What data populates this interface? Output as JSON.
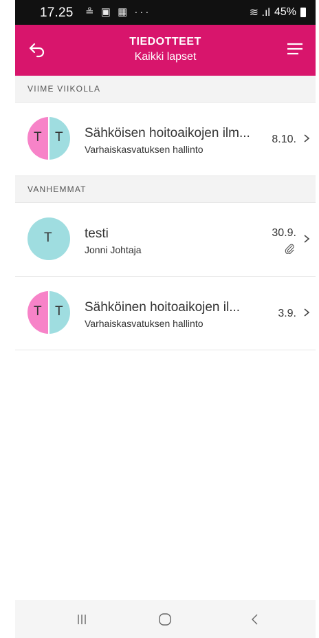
{
  "status_bar": {
    "time": "17.25",
    "notification_icons": "≗ ▣ ▦ ···",
    "signal_text": "≋ .ıl",
    "battery": "45%"
  },
  "header": {
    "title": "TIEDOTTEET",
    "subtitle": "Kaikki lapset",
    "background_color": "#d8156c"
  },
  "sections": [
    {
      "label": "VIIME VIIKOLLA",
      "items": [
        {
          "title": "Sähköisen hoitoaikojen ilm...",
          "sender": "Varhaiskasvatuksen hallinto",
          "date": "8.10.",
          "avatar_letters": [
            "T",
            "T"
          ],
          "has_attachment": false
        }
      ]
    },
    {
      "label": "VANHEMMAT",
      "items": [
        {
          "title": "testi",
          "sender": "Jonni Johtaja",
          "date": "30.9.",
          "avatar_letters": [
            "T"
          ],
          "has_attachment": true
        },
        {
          "title": "Sähköinen hoitoaikojen il...",
          "sender": "Varhaiskasvatuksen hallinto",
          "date": "3.9.",
          "avatar_letters": [
            "T",
            "T"
          ],
          "has_attachment": false
        }
      ]
    }
  ],
  "colors": {
    "avatar_pink": "#f783c8",
    "avatar_teal": "#9fdde0"
  },
  "nav_bar": {
    "icons": [
      "recent-apps-icon",
      "home-icon",
      "back-icon"
    ]
  }
}
